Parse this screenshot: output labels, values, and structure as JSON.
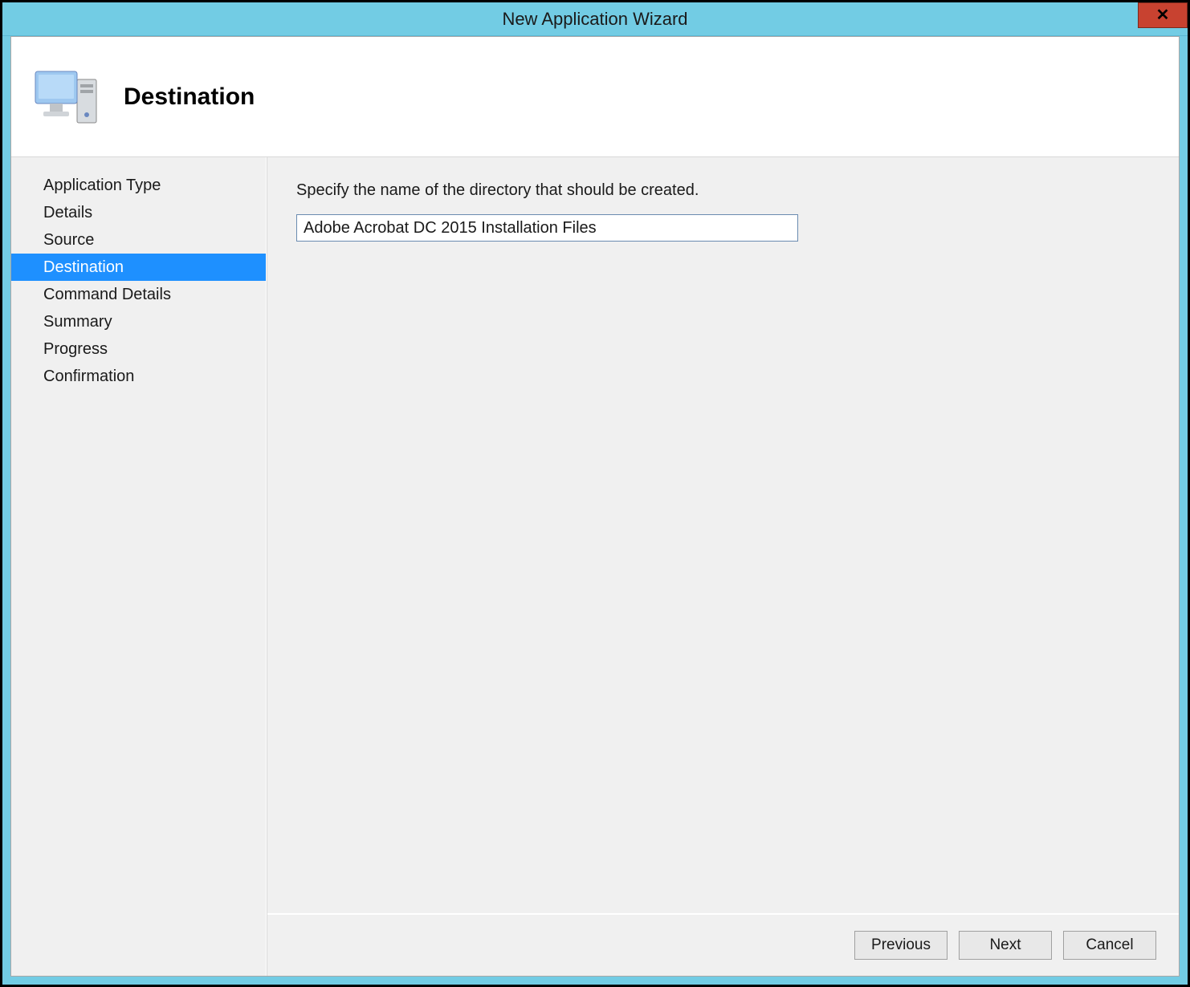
{
  "window": {
    "title": "New Application Wizard"
  },
  "header": {
    "title": "Destination",
    "icon": "computer-monitor-icon"
  },
  "sidebar": {
    "items": [
      {
        "label": "Application Type",
        "selected": false
      },
      {
        "label": "Details",
        "selected": false
      },
      {
        "label": "Source",
        "selected": false
      },
      {
        "label": "Destination",
        "selected": true
      },
      {
        "label": "Command Details",
        "selected": false
      },
      {
        "label": "Summary",
        "selected": false
      },
      {
        "label": "Progress",
        "selected": false
      },
      {
        "label": "Confirmation",
        "selected": false
      }
    ]
  },
  "main": {
    "instruction": "Specify the name of the directory that should be created.",
    "directory_value": "Adobe Acrobat DC 2015 Installation Files"
  },
  "buttons": {
    "previous": "Previous",
    "next": "Next",
    "cancel": "Cancel"
  }
}
